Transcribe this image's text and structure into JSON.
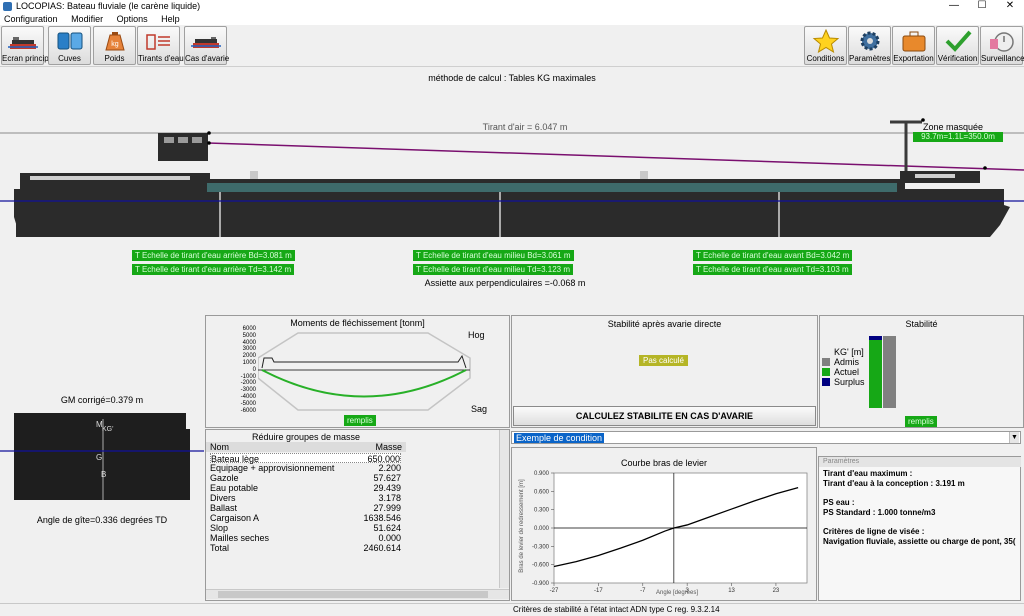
{
  "window": {
    "title": "LOCOPIAS: Bateau fluviale  (le carène liquide)",
    "minimize": "—",
    "maximize": "☐",
    "close": "✕"
  },
  "menu": [
    "Configuration",
    "Modifier",
    "Options",
    "Help"
  ],
  "toolbar_left": [
    {
      "label": "Ecran principal",
      "icon": "ship-icon"
    },
    {
      "label": "Cuves",
      "icon": "tanks-icon"
    },
    {
      "label": "Poids",
      "icon": "weight-bag-icon"
    },
    {
      "label": "Tirants d'eau",
      "icon": "draught-icon"
    },
    {
      "label": "Cas d'avarie",
      "icon": "damaged-ship-icon"
    }
  ],
  "toolbar_right": [
    {
      "label": "Conditions",
      "icon": "star-icon"
    },
    {
      "label": "Paramètres",
      "icon": "gear-icon"
    },
    {
      "label": "Exportation",
      "icon": "briefcase-icon"
    },
    {
      "label": "Vérification",
      "icon": "checkmark-icon"
    },
    {
      "label": "Surveillance",
      "icon": "stopwatch-icon"
    }
  ],
  "ship": {
    "method": "méthode de calcul : Tables KG maximales",
    "air_draught": "Tirant d'air = 6.047 m",
    "masked_zone_title": "Zone masquée",
    "masked_zone_value": "93.7m=1.1L=350.0m",
    "draft_aft_bd": "T Echelle de tirant d'eau arrière Bd=3.081 m",
    "draft_aft_td": "T Echelle de tirant d'eau arrière Td=3.142 m",
    "draft_mid_bd": "T Echelle de tirant d'eau milieu Bd=3.061 m",
    "draft_mid_td": "T Echelle de tirant d'eau milieu Td=3.123 m",
    "draft_fwd_bd": "T Echelle de tirant d'eau avant Bd=3.042 m",
    "draft_fwd_td": "T Echelle de tirant d'eau avant Td=3.103 m",
    "trim": "Assiette aux perpendiculaires =-0.068 m"
  },
  "section": {
    "gm": "GM corrigé=0.379 m",
    "heel": "Angle de gîte=0.336 degrées TD",
    "m_label": "M",
    "kg_label": "KG'",
    "g_label": "G",
    "b_label": "B"
  },
  "bending": {
    "title": "Moments de fléchissement [tonm]",
    "hog": "Hog",
    "sag": "Sag",
    "status": "remplis",
    "y_ticks": [
      "6000",
      "5000",
      "4000",
      "3000",
      "2000",
      "1000",
      "0",
      "-1000",
      "-2000",
      "-3000",
      "-4000",
      "-5000",
      "-6000"
    ]
  },
  "mass_groups": {
    "title": "Réduire groupes de masse",
    "col_name": "Nom",
    "col_mass": "Masse",
    "rows": [
      {
        "name": "Bateau lège",
        "mass": "650.000"
      },
      {
        "name": "Equipage + approvisionnement",
        "mass": "2.200"
      },
      {
        "name": "Gazole",
        "mass": "57.627"
      },
      {
        "name": "Eau potable",
        "mass": "29.439"
      },
      {
        "name": "Divers",
        "mass": "3.178"
      },
      {
        "name": "Ballast",
        "mass": "27.999"
      },
      {
        "name": "Cargaison A",
        "mass": "1638.546"
      },
      {
        "name": "Slop",
        "mass": "51.624"
      },
      {
        "name": "Mailles seches",
        "mass": "0.000"
      },
      {
        "name": "Total",
        "mass": "2460.614"
      }
    ]
  },
  "damage": {
    "title": "Stabilité après avarie directe",
    "status": "Pas calculé",
    "button": "CALCULEZ STABILITE EN CAS D'AVARIE"
  },
  "stability": {
    "title": "Stabilité",
    "legend_title": "KG' [m]",
    "legend": [
      {
        "label": "Admis",
        "color": "#808080"
      },
      {
        "label": "Actuel",
        "color": "#16a816"
      },
      {
        "label": "Surplus",
        "color": "#000080"
      }
    ],
    "status": "remplis"
  },
  "condition": {
    "selected": "Exemple de condition"
  },
  "gz_curve": {
    "title": "Courbe bras de levier",
    "xlabel": "Angle [degrées]",
    "ylabel": "Bras de levier de redressement [m]",
    "y_ticks": [
      "0.900",
      "0.600",
      "0.300",
      "0.000",
      "-0.300",
      "-0.600",
      "-0.900"
    ],
    "x_ticks": [
      "-27",
      "-17",
      "-7",
      "3",
      "13",
      "23"
    ]
  },
  "chart_data": {
    "type": "line",
    "title": "Courbe bras de levier",
    "xlabel": "Angle [degrées]",
    "ylabel": "Bras de levier de redressement [m]",
    "xlim": [
      -27,
      30
    ],
    "ylim": [
      -0.9,
      0.9
    ],
    "series": [
      {
        "x": [
          -27,
          -22,
          -17,
          -12,
          -7,
          -2,
          0,
          3,
          8,
          13,
          18,
          23,
          28
        ],
        "y": [
          -0.63,
          -0.55,
          -0.45,
          -0.33,
          -0.2,
          -0.05,
          0.0,
          0.05,
          0.18,
          0.31,
          0.44,
          0.56,
          0.66
        ]
      }
    ]
  },
  "params": {
    "header": "Paramètres",
    "line1": "Tirant d'eau maximum :",
    "line2": "Tirant d'eau à la conception : 3.191 m",
    "line3": "PS eau :",
    "line4": "PS Standard : 1.000 tonne/m3",
    "line5": "Critères de ligne de visée :",
    "line6": "Navigation fluviale, assiette ou charge de pont, 35("
  },
  "statusbar": {
    "text": "Critères de stabilité à l'état intact ADN type C reg. 9.3.2.14"
  }
}
